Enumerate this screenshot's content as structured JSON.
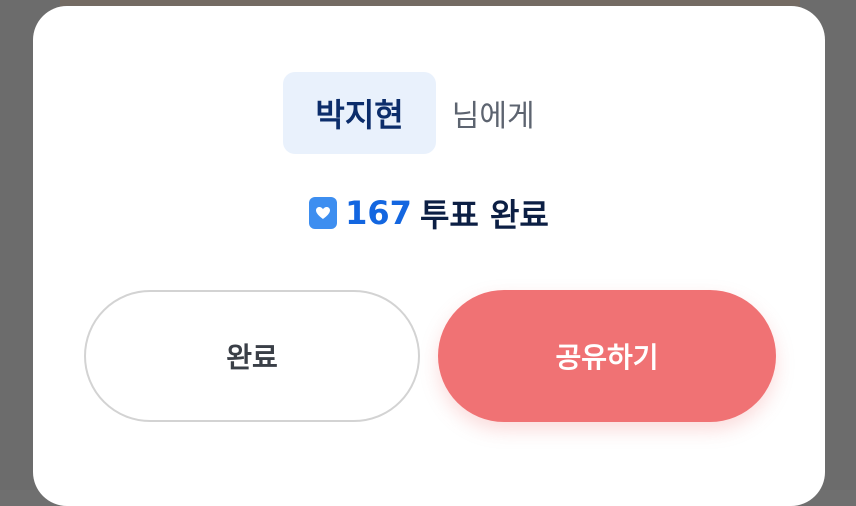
{
  "dialog": {
    "recipient_name": "박지현",
    "recipient_suffix": "님에게",
    "vote_count": "167",
    "vote_text": "투표 완료"
  },
  "buttons": {
    "done_label": "완료",
    "share_label": "공유하기"
  },
  "colors": {
    "accent_blue": "#1366e0",
    "share_button": "#f07274",
    "name_chip_bg": "#e9f1fc"
  },
  "icons": {
    "vote": "heart-icon"
  }
}
